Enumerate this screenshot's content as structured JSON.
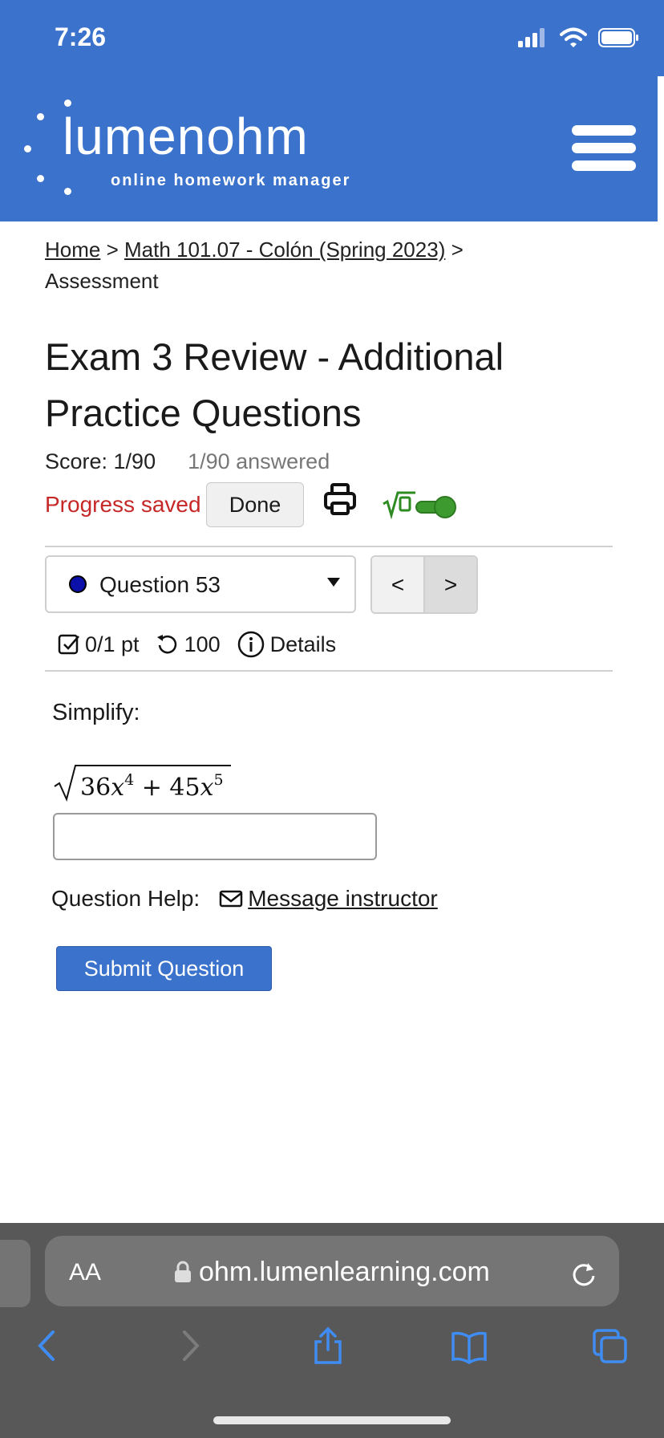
{
  "status_bar": {
    "time": "7:26"
  },
  "header": {
    "brand": "lumenohm",
    "tagline": "online homework manager"
  },
  "breadcrumb": {
    "home": "Home",
    "sep1": " > ",
    "course": "Math 101.07 - Colón (Spring 2023)",
    "sep2": " > ",
    "current": "Assessment"
  },
  "assessment": {
    "title": "Exam 3 Review - Additional Practice Questions",
    "score": "Score: 1/90",
    "answered": "1/90 answered",
    "progress": "Progress saved",
    "done_label": "Done"
  },
  "question_nav": {
    "selected": "Question 53",
    "prev": "<",
    "next": ">"
  },
  "question_meta": {
    "points": "0/1 pt",
    "retries": "100",
    "details": "Details"
  },
  "question": {
    "prompt": "Simplify:",
    "expression": "√(36x⁴ + 45x⁵)",
    "answer_value": "",
    "help_label": "Question Help:",
    "message_link": "Message instructor",
    "submit_label": "Submit Question"
  },
  "browser": {
    "aa_label": "AA",
    "url": "ohm.lumenlearning.com"
  },
  "colors": {
    "header_blue": "#3a72cc",
    "progress_red": "#c62828",
    "toggle_green": "#3c9a2f"
  }
}
